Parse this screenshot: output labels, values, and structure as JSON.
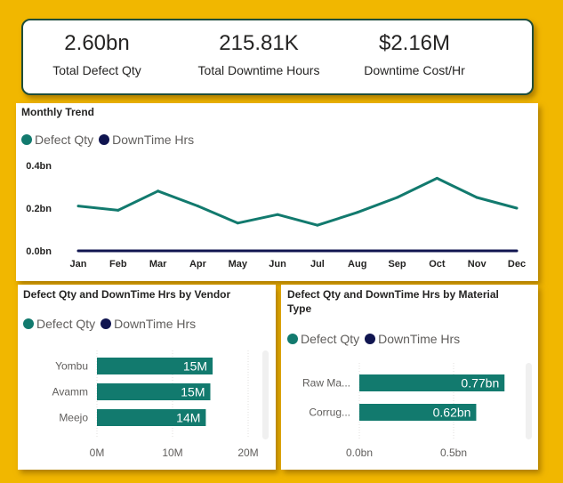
{
  "colors": {
    "defect": "#127a6e",
    "downtime": "#101550",
    "axis_text": "#605e5c",
    "grid": "#e1dfdd"
  },
  "kpis": [
    {
      "value": "2.60bn",
      "label": "Total Defect Qty"
    },
    {
      "value": "215.81K",
      "label": "Total Downtime Hours"
    },
    {
      "value": "$2.16M",
      "label": "Downtime Cost/Hr"
    }
  ],
  "legend": {
    "defect": "Defect Qty",
    "downtime": "DownTime Hrs"
  },
  "chart_data": [
    {
      "type": "line",
      "title": "Monthly Trend",
      "categories": [
        "Jan",
        "Feb",
        "Mar",
        "Apr",
        "May",
        "Jun",
        "Jul",
        "Aug",
        "Sep",
        "Oct",
        "Nov",
        "Dec"
      ],
      "y_ticks": [
        "0.0bn",
        "0.2bn",
        "0.4bn"
      ],
      "ylim": [
        0,
        0.4
      ],
      "series": [
        {
          "name": "Defect Qty",
          "values": [
            0.21,
            0.19,
            0.28,
            0.21,
            0.13,
            0.17,
            0.12,
            0.18,
            0.25,
            0.34,
            0.25,
            0.2
          ]
        },
        {
          "name": "DownTime Hrs",
          "values": [
            0,
            0,
            0,
            0,
            0,
            0,
            0,
            0,
            0,
            0,
            0,
            0
          ]
        }
      ],
      "legend_position": "top-left"
    },
    {
      "type": "bar",
      "orientation": "horizontal",
      "title": "Defect Qty and DownTime Hrs by Vendor",
      "categories": [
        "Yombu",
        "Avamm",
        "Meejo"
      ],
      "x_ticks": [
        "0M",
        "10M",
        "20M"
      ],
      "xlim": [
        0,
        20
      ],
      "series": [
        {
          "name": "Defect Qty",
          "values": [
            15.3,
            15.0,
            14.4
          ],
          "labels": [
            "15M",
            "15M",
            "14M"
          ]
        }
      ],
      "legend_position": "top-left"
    },
    {
      "type": "bar",
      "orientation": "horizontal",
      "title": "Defect Qty and DownTime Hrs by Material Type",
      "categories": [
        "Raw Ma...",
        "Corrug..."
      ],
      "x_ticks": [
        "0.0bn",
        "0.5bn"
      ],
      "xlim": [
        0,
        0.5
      ],
      "series": [
        {
          "name": "Defect Qty",
          "values": [
            0.77,
            0.62
          ],
          "labels": [
            "0.77bn",
            "0.62bn"
          ]
        }
      ],
      "legend_position": "top-left"
    }
  ]
}
